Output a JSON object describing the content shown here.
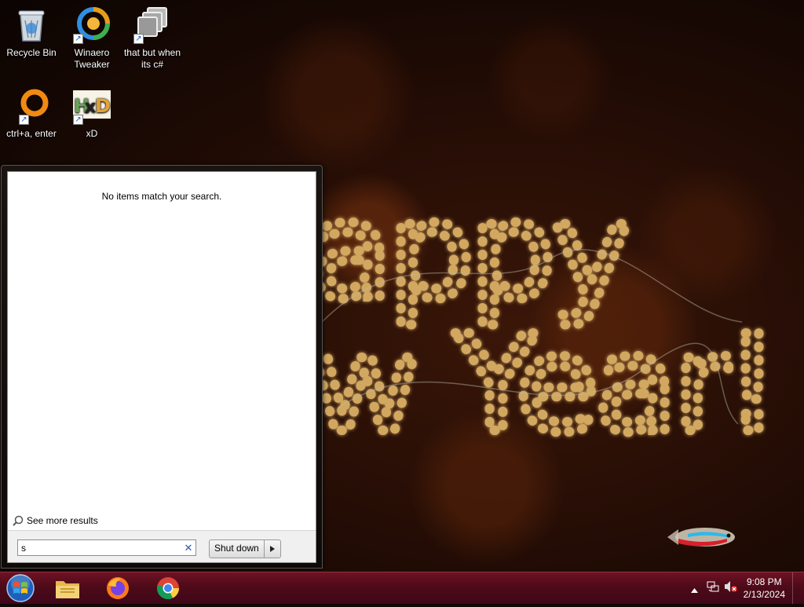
{
  "desktop": {
    "icons": [
      {
        "label": "Recycle Bin"
      },
      {
        "label": "Winaero Tweaker"
      },
      {
        "label": "that but when its c#"
      },
      {
        "label": "ctrl+a, enter"
      },
      {
        "label": "xD"
      }
    ],
    "wallpaper_text": "Happy New Year!"
  },
  "start_menu": {
    "no_results": "No items match your search.",
    "see_more": "See more results",
    "search": {
      "value": "s",
      "clear_icon": "clear-x-icon"
    },
    "shutdown_label": "Shut down"
  },
  "taskbar": {
    "apps": [
      "windows-explorer",
      "firefox",
      "chrome"
    ],
    "clock": {
      "time": "9:08 PM",
      "date": "2/13/2024"
    }
  },
  "colors": {
    "taskbar": "#5a0e1e",
    "accent_text": "#f3d58a"
  }
}
